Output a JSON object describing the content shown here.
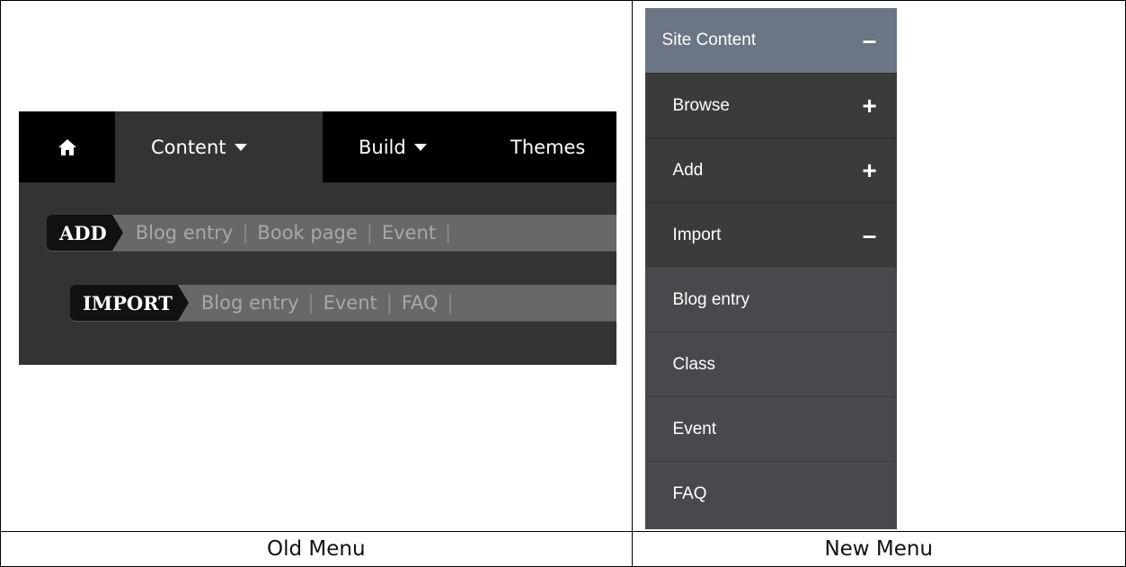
{
  "captions": {
    "old": "Old Menu",
    "new": "New Menu"
  },
  "old_menu": {
    "home_icon": "home-icon",
    "tabs": [
      {
        "label": "Content",
        "has_caret": true,
        "active": true
      },
      {
        "label": "Build",
        "has_caret": true,
        "active": false
      },
      {
        "label": "Themes",
        "has_caret": false,
        "active": false
      }
    ],
    "add_bar": {
      "heading": "ADD",
      "items": [
        "Blog entry",
        "Book page",
        "Event"
      ]
    },
    "import_bar": {
      "heading": "IMPORT",
      "items": [
        "Blog entry",
        "Event",
        "FAQ"
      ]
    }
  },
  "new_menu": {
    "header": {
      "label": "Site Content",
      "toggle": "–"
    },
    "sections": [
      {
        "label": "Browse",
        "toggle": "+"
      },
      {
        "label": "Add",
        "toggle": "+"
      },
      {
        "label": "Import",
        "toggle": "–"
      }
    ],
    "import_items": [
      "Blog entry",
      "Class",
      "Event",
      "FAQ"
    ]
  },
  "colors": {
    "old_topbar": "#000000",
    "old_panel": "#333333",
    "old_crumb": "#686868",
    "new_header": "#6b7584",
    "new_section": "#3b3b3b",
    "new_item": "#47494d"
  }
}
